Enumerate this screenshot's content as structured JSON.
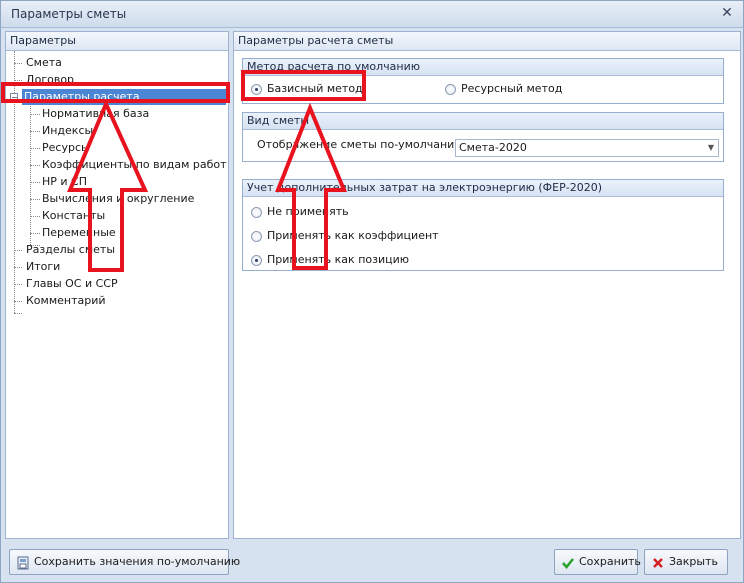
{
  "window": {
    "title": "Параметры сметы"
  },
  "left": {
    "header": "Параметры",
    "tree": [
      "Смета",
      "Договор",
      "Параметры расчета",
      "Нормативная база",
      "Индексы",
      "Ресурсы",
      "Коэффициенты по видам работ",
      "НР и СП",
      "Вычисления и округление",
      "Константы",
      "Переменные",
      "Разделы сметы",
      "Итоги",
      "Главы ОС и ССР",
      "Комментарий"
    ]
  },
  "right": {
    "header": "Параметры расчета сметы",
    "method": {
      "title": "Метод расчета по умолчанию",
      "options": [
        "Базисный метод",
        "Ресурсный метод"
      ],
      "selected": "Базисный метод"
    },
    "view": {
      "title": "Вид сметы",
      "label": "Отображение сметы по-умолчанию:",
      "value": "Смета-2020"
    },
    "energy": {
      "title": "Учет дополнительных затрат на электроэнергию (ФЕР-2020)",
      "options": [
        "Не применять",
        "Применять как коэффициент",
        "Применять как позицию"
      ],
      "selected": "Применять как позицию"
    }
  },
  "footer": {
    "save_defaults": "Сохранить значения по-умолчанию",
    "save": "Сохранить",
    "close": "Закрыть"
  },
  "icons": {
    "close_window": "close-icon",
    "save_defaults": "save-defaults-icon",
    "save": "checkmark-icon",
    "close": "cross-icon"
  },
  "colors": {
    "selection": "#4a86d3",
    "annotation": "#e8131f"
  }
}
